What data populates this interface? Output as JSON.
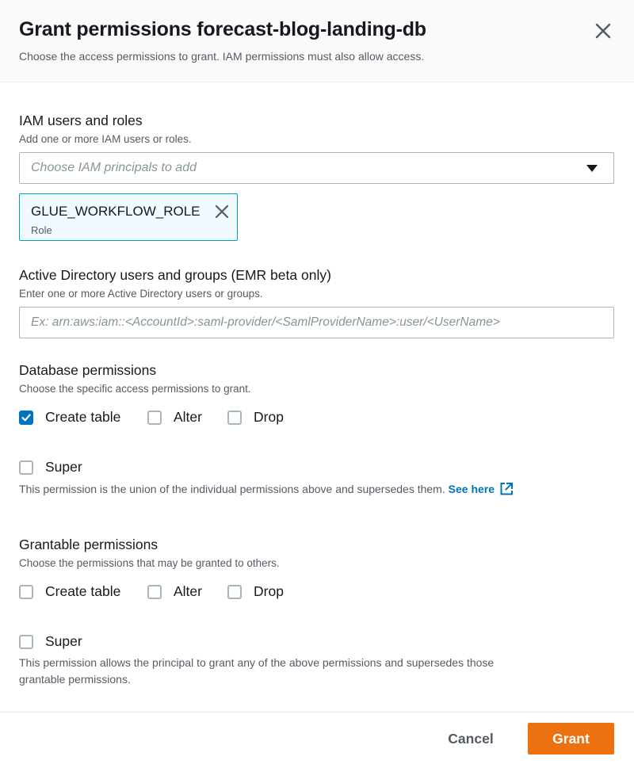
{
  "header": {
    "title": "Grant permissions forecast-blog-landing-db",
    "subtitle": "Choose the access permissions to grant. IAM permissions must also allow access."
  },
  "iam": {
    "label": "IAM users and roles",
    "description": "Add one or more IAM users or roles.",
    "placeholder": "Choose IAM principals to add",
    "selected": [
      {
        "name": "GLUE_WORKFLOW_ROLE",
        "type": "Role"
      }
    ]
  },
  "ad": {
    "label": "Active Directory users and groups (EMR beta only)",
    "description": "Enter one or more Active Directory users or groups.",
    "placeholder": "Ex: arn:aws:iam::<AccountId>:saml-provider/<SamlProviderName>:user/<UserName>",
    "value": ""
  },
  "database_permissions": {
    "label": "Database permissions",
    "description": "Choose the specific access permissions to grant.",
    "options": [
      {
        "label": "Create table",
        "checked": true
      },
      {
        "label": "Alter",
        "checked": false
      },
      {
        "label": "Drop",
        "checked": false
      }
    ],
    "super": {
      "label": "Super",
      "checked": false
    },
    "super_help": "This permission is the union of the individual permissions above and supersedes them.",
    "super_link": "See here"
  },
  "grantable_permissions": {
    "label": "Grantable permissions",
    "description": "Choose the permissions that may be granted to others.",
    "options": [
      {
        "label": "Create table",
        "checked": false
      },
      {
        "label": "Alter",
        "checked": false
      },
      {
        "label": "Drop",
        "checked": false
      }
    ],
    "super": {
      "label": "Super",
      "checked": false
    },
    "super_help_line1": "This permission allows the principal to grant any of the above permissions and supersedes those",
    "super_help_line2": "grantable permissions."
  },
  "footer": {
    "cancel_label": "Cancel",
    "grant_label": "Grant"
  },
  "colors": {
    "primary_button": "#ec7211",
    "checkbox_checked": "#0073bb",
    "link": "#0073bb",
    "token_border": "#00a1c9",
    "token_background": "#f1faff"
  },
  "icons": {
    "close": "close-icon",
    "caret": "caret-down-icon",
    "checkmark": "checkmark-icon",
    "external_link": "external-link-icon"
  }
}
